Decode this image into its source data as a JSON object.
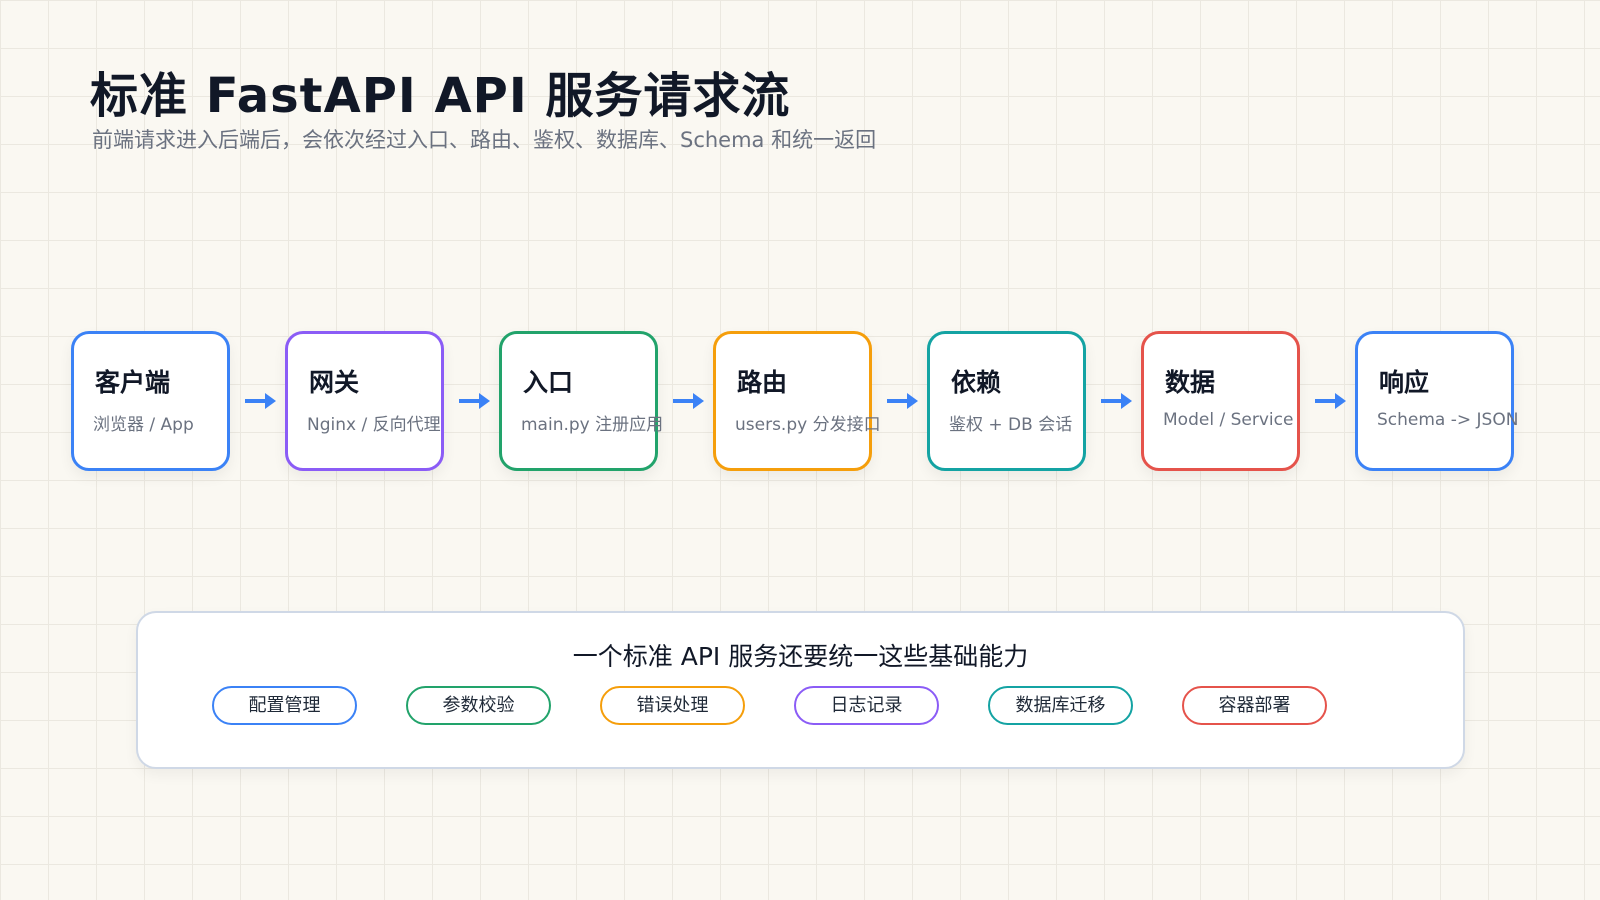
{
  "title": "标准 FastAPI API 服务请求流",
  "subtitle": "前端请求进入后端后，会依次经过入口、路由、鉴权、数据库、Schema 和统一返回",
  "flow": {
    "nodes": [
      {
        "title": "客户端",
        "desc": "浏览器 / App",
        "color": "#3b82f6"
      },
      {
        "title": "网关",
        "desc": "Nginx / 反向代理",
        "color": "#8b5cf6"
      },
      {
        "title": "入口",
        "desc": "main.py 注册应用",
        "color": "#22a36b"
      },
      {
        "title": "路由",
        "desc": "users.py 分发接口",
        "color": "#f59e0b"
      },
      {
        "title": "依赖",
        "desc": "鉴权 + DB 会话",
        "color": "#14a3a3"
      },
      {
        "title": "数据",
        "desc": "Model / Service",
        "color": "#e5534b"
      },
      {
        "title": "响应",
        "desc": "Schema -> JSON",
        "color": "#3b82f6"
      }
    ],
    "arrow_color": "#3b82f6"
  },
  "capabilities": {
    "title": "一个标准 API 服务还要统一这些基础能力",
    "items": [
      {
        "label": "配置管理",
        "color": "#3b82f6"
      },
      {
        "label": "参数校验",
        "color": "#22a36b"
      },
      {
        "label": "错误处理",
        "color": "#f59e0b"
      },
      {
        "label": "日志记录",
        "color": "#8b5cf6"
      },
      {
        "label": "数据库迁移",
        "color": "#14a3a3"
      },
      {
        "label": "容器部署",
        "color": "#e5534b"
      }
    ]
  }
}
